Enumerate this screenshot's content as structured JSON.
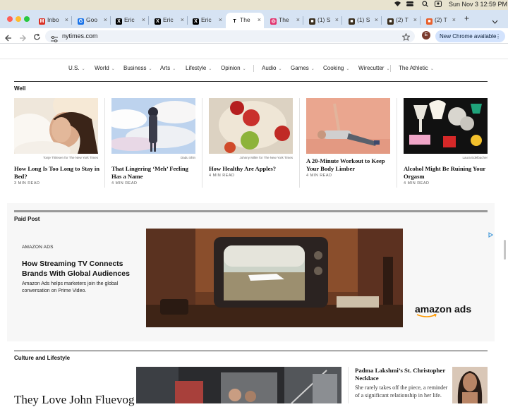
{
  "menubar": {
    "date_time": "Sun Nov 3  12:59 PM"
  },
  "tabs": [
    {
      "label": "Inbo",
      "icon": "gmail-icon",
      "color": "#d93025",
      "glyph": "M"
    },
    {
      "label": "Goo",
      "icon": "google-icon",
      "color": "#1a73e8",
      "glyph": "G"
    },
    {
      "label": "Eric",
      "icon": "x-icon",
      "color": "#000000",
      "glyph": "X"
    },
    {
      "label": "Eric",
      "icon": "x-icon",
      "color": "#000000",
      "glyph": "X"
    },
    {
      "label": "Eric",
      "icon": "x-icon",
      "color": "#000000",
      "glyph": "X"
    },
    {
      "label": "The",
      "icon": "nyt-icon",
      "color": "#ffffff",
      "glyph": "T",
      "active": true
    },
    {
      "label": "The",
      "icon": "instagram-icon",
      "color": "#e1306c",
      "glyph": "◎"
    },
    {
      "label": "(1) S",
      "icon": "site-icon",
      "color": "#3b2f1f",
      "glyph": "■"
    },
    {
      "label": "(1) S",
      "icon": "site-icon",
      "color": "#3b2f1f",
      "glyph": "■"
    },
    {
      "label": "(2) T",
      "icon": "site-icon",
      "color": "#3b2f1f",
      "glyph": "■"
    },
    {
      "label": "(2) T",
      "icon": "site-icon",
      "color": "#e8602c",
      "glyph": "■"
    }
  ],
  "toolbar": {
    "url": "nytimes.com",
    "new_chrome": "New Chrome available",
    "profile_initial": "E"
  },
  "nav": {
    "items": [
      "U.S.",
      "World",
      "Business",
      "Arts",
      "Lifestyle",
      "Opinion",
      "Audio",
      "Games",
      "Cooking",
      "Wirecutter",
      "The Athletic"
    ]
  },
  "well": {
    "label": "Well",
    "cards": [
      {
        "credit": "Tonje Thilesen for The New York Times",
        "headline": "How Long Is Too Long to Stay in Bed?",
        "readtime": "3 MIN READ"
      },
      {
        "credit": "Dadu Shin",
        "headline": "That Lingering ‘Meh’ Feeling Has a Name",
        "readtime": "4 MIN READ"
      },
      {
        "credit": "Johnny Miller for The New York Times",
        "headline": "How Healthy Are Apples?",
        "readtime": "4 MIN READ"
      },
      {
        "credit": "",
        "headline": "A 20-Minute Workout to Keep Your Body Limber",
        "readtime": "4 MIN READ"
      },
      {
        "credit": "Laura Edelbacher",
        "headline": "Alcohol Might Be Ruining Your Orgasm",
        "readtime": "4 MIN READ"
      }
    ]
  },
  "paid_post": {
    "label": "Paid Post",
    "brand": "AMAZON ADS",
    "headline": "How Streaming TV Connects Brands With Global Audiences",
    "body": "Amazon Ads helps marketers join the global conversation on Prime Video.",
    "logo_text": "amazon ads"
  },
  "culture": {
    "label": "Culture and Lifestyle",
    "lead_headline": "They Love John Fluevog",
    "side_headline": "Padma Lakshmi’s St. Christopher Necklace",
    "side_summary": "She rarely takes off the piece, a reminder of a significant relationship in her life."
  },
  "colors": {
    "tabbar": "#d6e3f3",
    "accent_chip": "#d3e3fd",
    "amazon_arrow": "#ff9900"
  }
}
